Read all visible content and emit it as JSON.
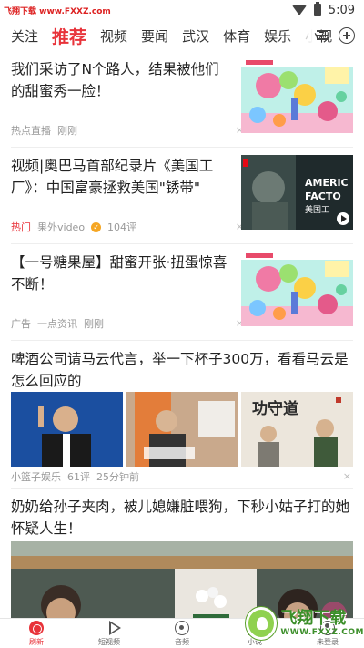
{
  "status_bar": {
    "watermark": "飞翔下载 www.FXXZ.com",
    "time": "5:09"
  },
  "tabs": [
    "关注",
    "推荐",
    "视频",
    "要闻",
    "武汉",
    "体育",
    "娱乐",
    "小视"
  ],
  "active_tab": "推荐",
  "feed": [
    {
      "title": "我们采访了N个路人，结果被他们的甜蜜秀一脸！",
      "meta": [
        "热点直播",
        "刚刚"
      ]
    },
    {
      "title": "视频|奥巴马首部纪录片《美国工厂》：中国富豪拯救美国\"锈带\"",
      "hot": "热门",
      "source": "果外video",
      "count": "104评",
      "thumb_text": [
        "AMERIC",
        "FACTO",
        "美国工"
      ]
    },
    {
      "title": "【一号糖果屋】甜蜜开张·扭蛋惊喜不断！",
      "meta": [
        "广告",
        "一点资讯",
        "刚刚"
      ]
    },
    {
      "title": "啤酒公司请马云代言，举一下杯子300万，看看马云是怎么回应的",
      "meta": [
        "小篮子娱乐",
        "61评",
        "25分钟前"
      ],
      "thumb_text": "功守道"
    },
    {
      "title": "奶奶给孙子夹肉，被儿媳嫌脏喂狗，下秒小姑子打的她怀疑人生！"
    }
  ],
  "dismiss_glyph": "×",
  "bottom_nav": [
    {
      "label": "刷新",
      "icon": "refresh-icon"
    },
    {
      "label": "短视频",
      "icon": "play-icon"
    },
    {
      "label": "音频",
      "icon": "audio-icon"
    },
    {
      "label": "小说",
      "icon": "book-icon"
    },
    {
      "label": "未登录",
      "icon": "user-icon"
    }
  ],
  "overlay": {
    "brand": "飞翔下载",
    "url": "WWW.FXXZ.COM"
  },
  "colors": {
    "accent": "#e8333a",
    "text": "#222222",
    "meta": "#999999"
  }
}
